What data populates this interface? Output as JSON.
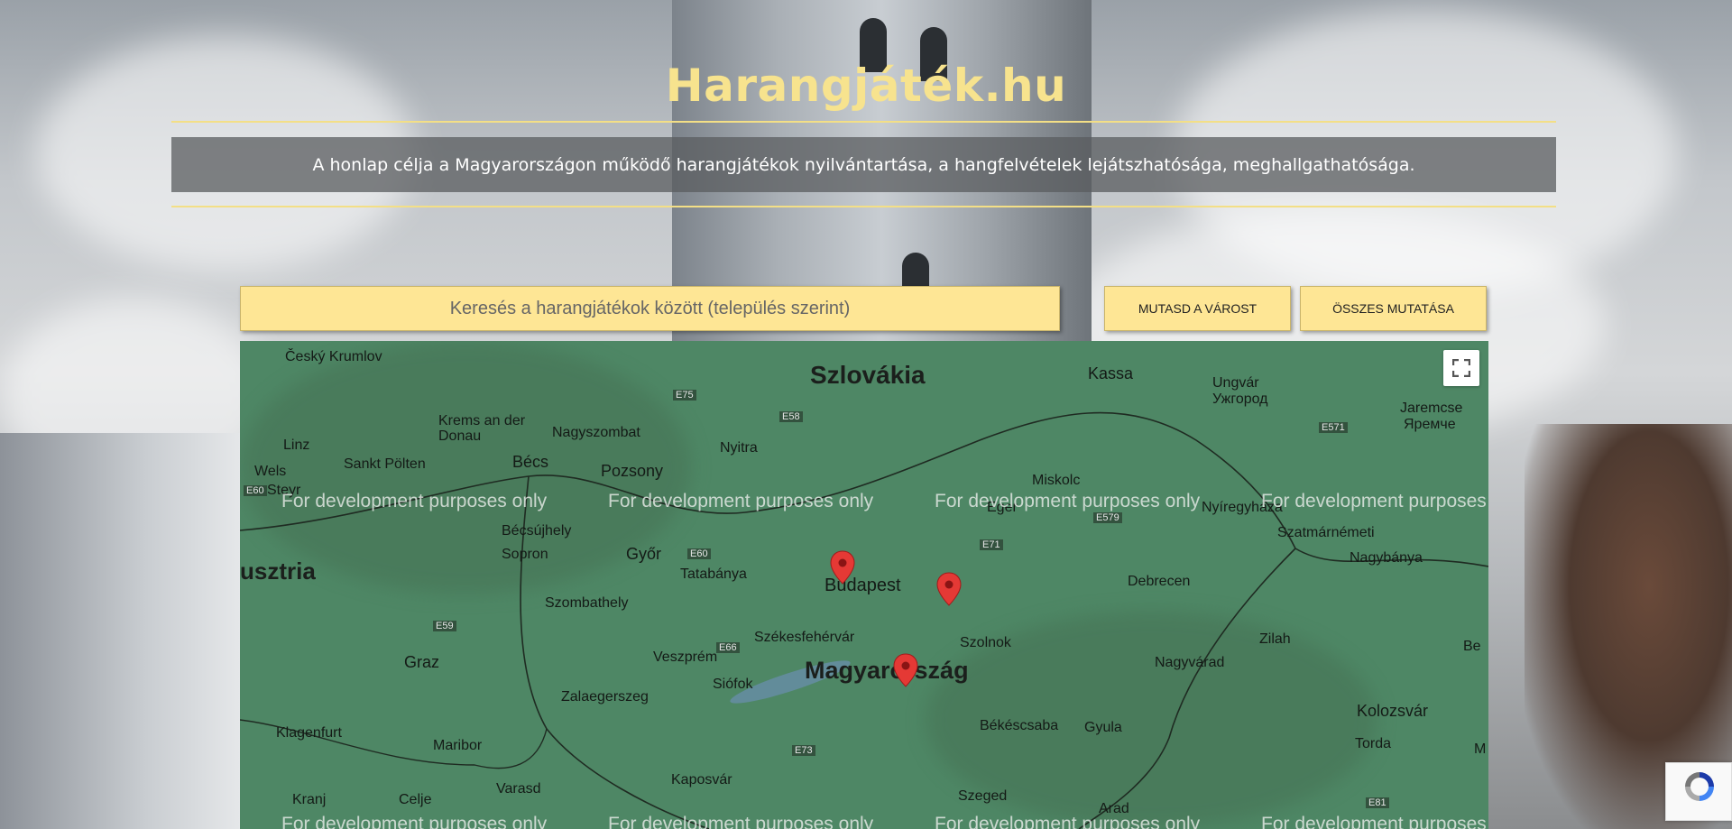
{
  "header": {
    "title": "Harangjáték.hu",
    "subtitle": "A honlap célja a Magyarországon működő harangjátékok nyilvántartása, a hangfelvételek lejátszhatósága, meghallgathatósága."
  },
  "search": {
    "placeholder": "Keresés a harangjátékok között (település szerint)",
    "value": ""
  },
  "buttons": {
    "show_city": "MUTASD A VÁROST",
    "show_all": "ÖSSZES MUTATÁSA"
  },
  "map": {
    "watermark": "For development purposes only",
    "countries": {
      "slovakia": "Szlovákia",
      "hungary": "Magyarország",
      "austria": "usztria"
    },
    "cities": [
      "Český Krumlov",
      "Krems an der Donau",
      "Linz",
      "Sankt Pölten",
      "Wels",
      "Steyr",
      "Bécs",
      "Pozsony",
      "Nagyszombat",
      "Nyitra",
      "Kassa",
      "Ungvár",
      "Ужгород",
      "Jaremcse",
      "Яремче",
      "Miskolc",
      "Eger",
      "Nyíregyháza",
      "Szatmárnémeti",
      "Nagybánya",
      "Bécsújhely",
      "Sopron",
      "Győr",
      "Tatabánya",
      "Budapest",
      "Debrecen",
      "Szombathely",
      "Székesfehérvár",
      "Szolnok",
      "Zilah",
      "Graz",
      "Veszprém",
      "Siófok",
      "Nagyvárad",
      "Zalaegerszeg",
      "Kolozsvár",
      "Klagenfurt",
      "Maribor",
      "Békéscsaba",
      "Gyula",
      "Torda",
      "Kaposvár",
      "Kranj",
      "Varasd",
      "Celje",
      "Szeged",
      "Arad",
      "Be",
      "M"
    ],
    "roads": [
      "E75",
      "E58",
      "E571",
      "E579",
      "E71",
      "E60",
      "E59",
      "E66",
      "E73",
      "E81",
      "E60"
    ],
    "markers": [
      "Budapest",
      "Eger region",
      "Kecskemét region"
    ]
  },
  "colors": {
    "accent": "#f7e38e",
    "button_bg": "#fee695",
    "map_bg": "#4e8765",
    "marker": "#e53935"
  },
  "icons": {
    "fullscreen": "fullscreen-icon",
    "marker": "map-marker-icon",
    "recaptcha": "recaptcha-icon"
  }
}
